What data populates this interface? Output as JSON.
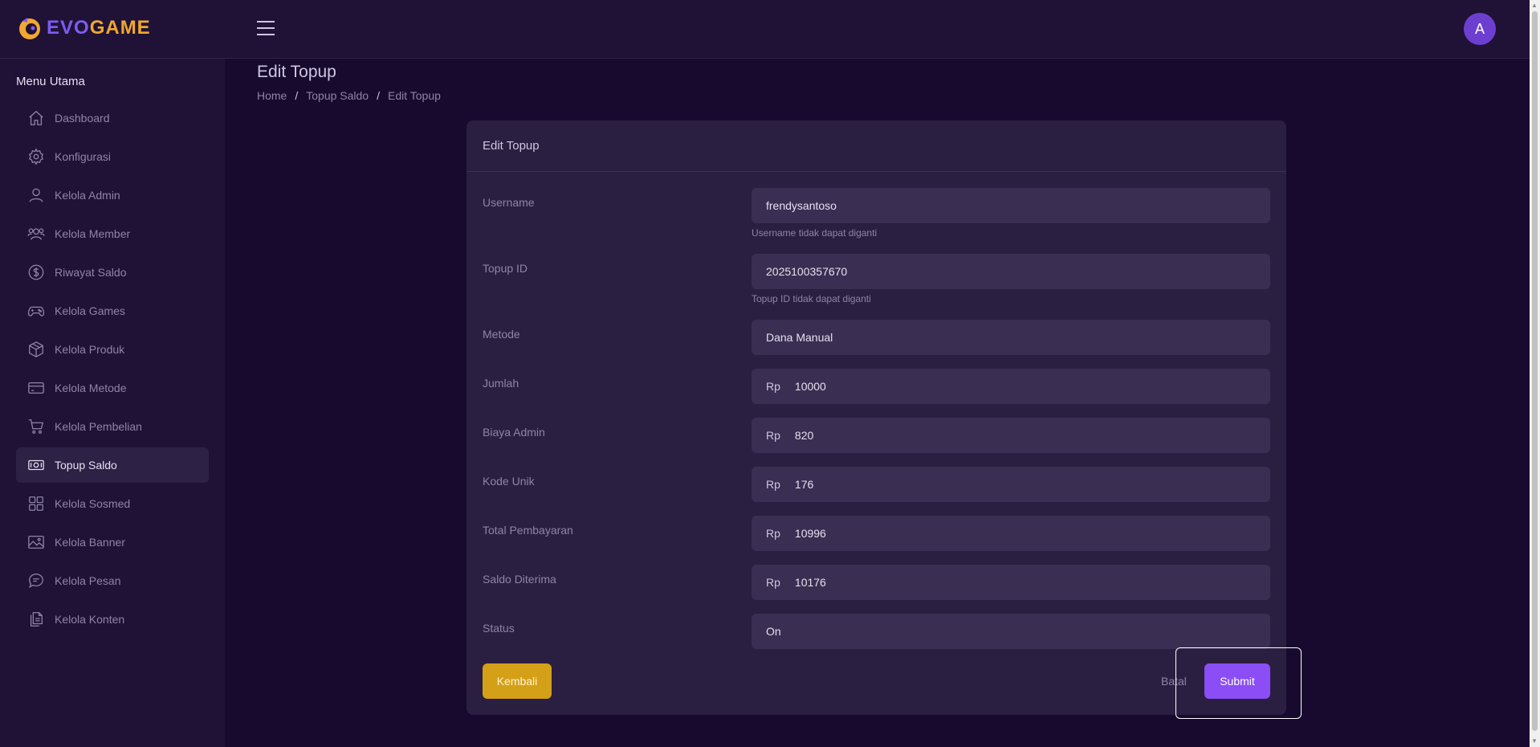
{
  "brand": {
    "evo": "EVO",
    "game": "GAME"
  },
  "header": {
    "avatar_initial": "A"
  },
  "sidebar": {
    "heading": "Menu Utama",
    "items": [
      {
        "label": "Dashboard",
        "icon": "home-icon"
      },
      {
        "label": "Konfigurasi",
        "icon": "gear-icon"
      },
      {
        "label": "Kelola Admin",
        "icon": "user-icon"
      },
      {
        "label": "Kelola Member",
        "icon": "users-icon"
      },
      {
        "label": "Riwayat Saldo",
        "icon": "dollar-icon"
      },
      {
        "label": "Kelola Games",
        "icon": "gamepad-icon"
      },
      {
        "label": "Kelola Produk",
        "icon": "box-icon"
      },
      {
        "label": "Kelola Metode",
        "icon": "card-icon"
      },
      {
        "label": "Kelola Pembelian",
        "icon": "cart-icon"
      },
      {
        "label": "Topup Saldo",
        "icon": "money-icon",
        "active": true
      },
      {
        "label": "Kelola Sosmed",
        "icon": "grid-icon"
      },
      {
        "label": "Kelola Banner",
        "icon": "image-icon"
      },
      {
        "label": "Kelola Pesan",
        "icon": "message-icon"
      },
      {
        "label": "Kelola Konten",
        "icon": "files-icon"
      }
    ]
  },
  "page": {
    "title": "Edit Topup",
    "breadcrumb": [
      "Home",
      "Topup Saldo",
      "Edit Topup"
    ]
  },
  "card": {
    "title": "Edit Topup",
    "fields": {
      "username": {
        "label": "Username",
        "value": "frendysantoso",
        "help": "Username tidak dapat diganti"
      },
      "topup_id": {
        "label": "Topup ID",
        "value": "2025100357670",
        "help": "Topup ID tidak dapat diganti"
      },
      "metode": {
        "label": "Metode",
        "value": "Dana Manual"
      },
      "jumlah": {
        "label": "Jumlah",
        "prefix": "Rp",
        "value": "10000"
      },
      "biaya_admin": {
        "label": "Biaya Admin",
        "prefix": "Rp",
        "value": "820"
      },
      "kode_unik": {
        "label": "Kode Unik",
        "prefix": "Rp",
        "value": "176"
      },
      "total_pembayaran": {
        "label": "Total Pembayaran",
        "prefix": "Rp",
        "value": "10996"
      },
      "saldo_diterima": {
        "label": "Saldo Diterima",
        "prefix": "Rp",
        "value": "10176"
      },
      "status": {
        "label": "Status",
        "value": "On"
      }
    },
    "buttons": {
      "back": "Kembali",
      "cancel": "Batal",
      "submit": "Submit"
    }
  },
  "colors": {
    "background": "#170a2e",
    "panel": "#1f1236",
    "card": "#2a1f40",
    "input": "#3a2f52",
    "accent_purple": "#8b4df5",
    "accent_gold": "#d4a018",
    "brand_evo": "#7c5cf0",
    "brand_game": "#f0a830"
  }
}
